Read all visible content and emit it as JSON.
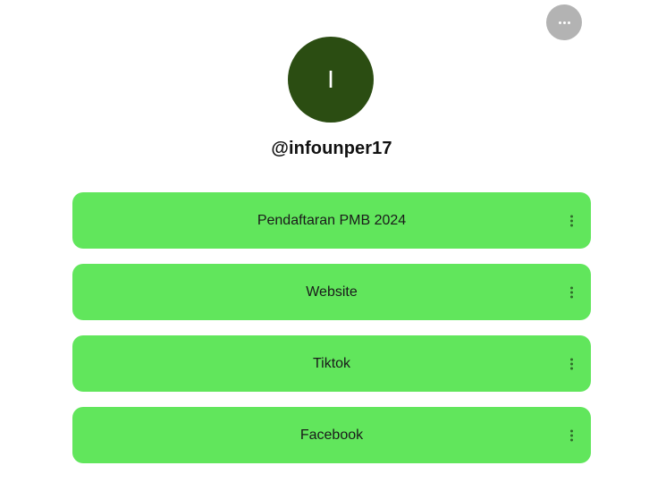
{
  "profile": {
    "avatar_initial": "I",
    "handle": "@infounper17"
  },
  "links": [
    {
      "label": "Pendaftaran PMB 2024"
    },
    {
      "label": "Website"
    },
    {
      "label": "Tiktok"
    },
    {
      "label": "Facebook"
    }
  ],
  "colors": {
    "background": "#ffffff",
    "avatar_bg": "#2b4d12",
    "link_bg": "#61e65c",
    "more_button_bg": "#b3b3b3"
  },
  "icons": {
    "more": "more-horizontal-icon",
    "link_menu": "more-vertical-icon"
  }
}
